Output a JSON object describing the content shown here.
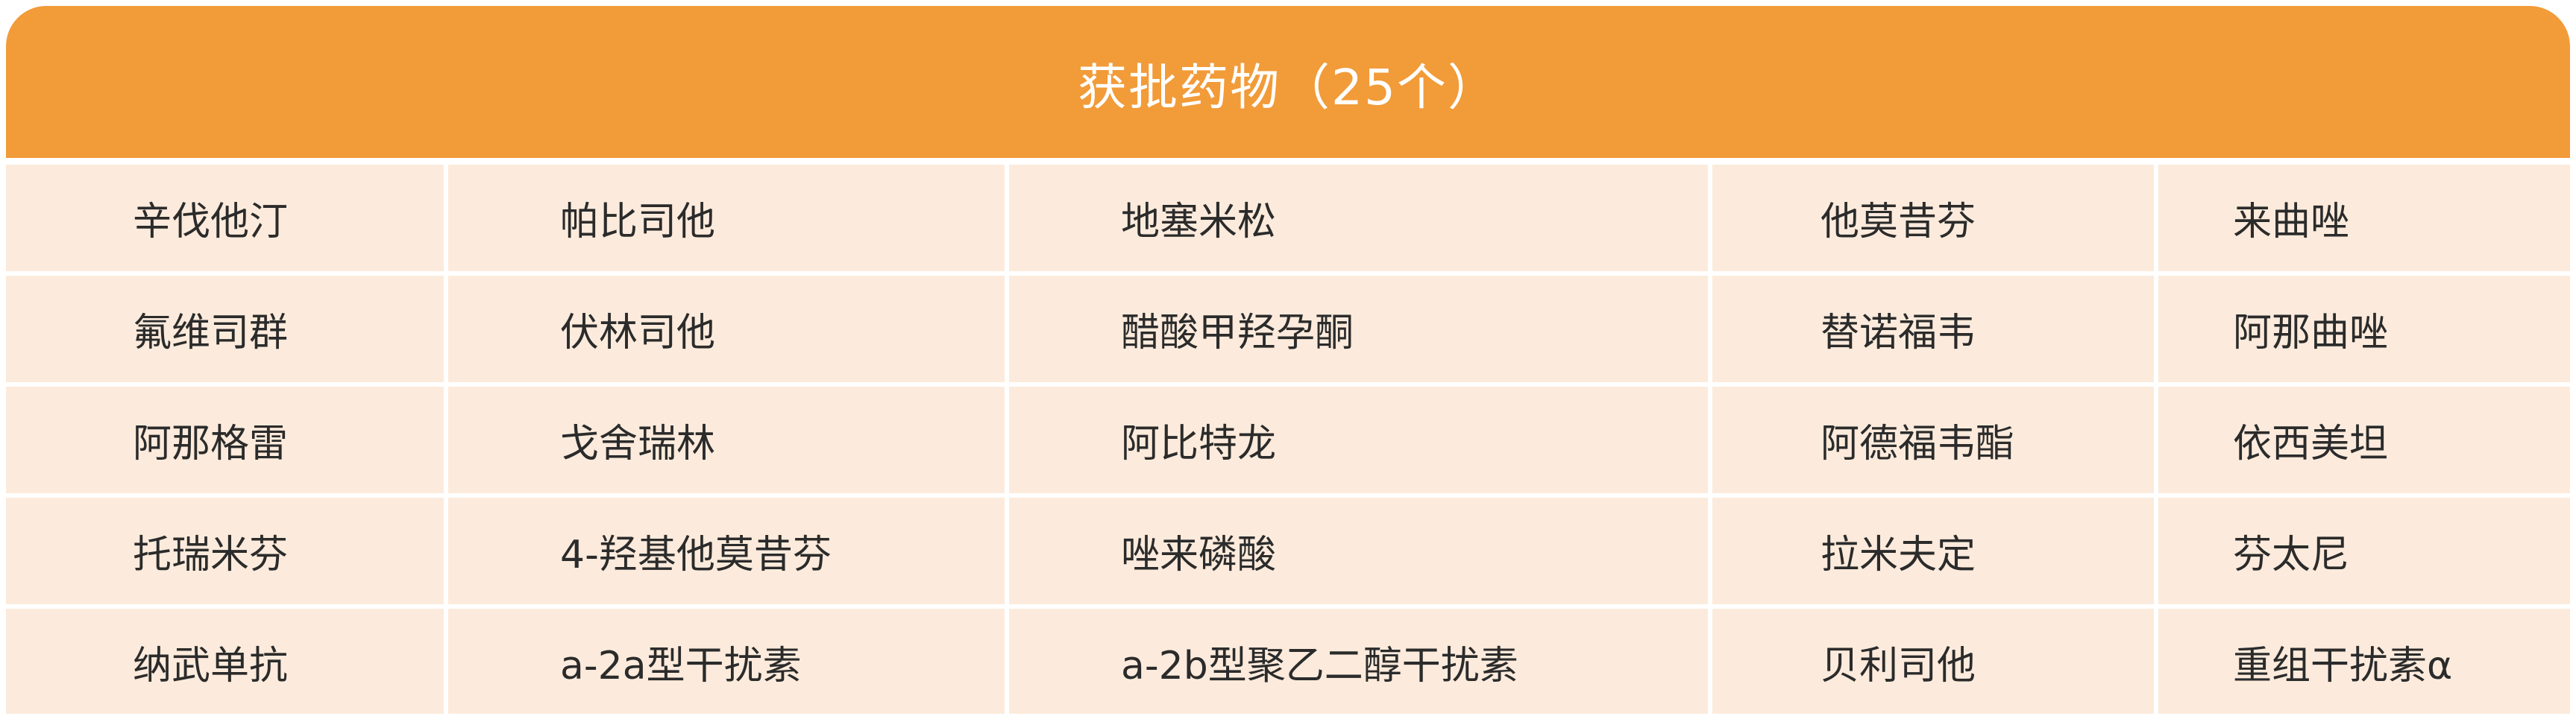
{
  "header": {
    "title": "获批药物（25个）"
  },
  "colors": {
    "header_bg": "#f29b39",
    "cell_bg": "#fcebdc",
    "text": "#2b2b2b"
  },
  "rows": [
    [
      "辛伐他汀",
      "帕比司他",
      "地塞米松",
      "他莫昔芬",
      "来曲唑"
    ],
    [
      "氟维司群",
      "伏林司他",
      "醋酸甲羟孕酮",
      "替诺福韦",
      "阿那曲唑"
    ],
    [
      "阿那格雷",
      "戈舍瑞林",
      "阿比特龙",
      "阿德福韦酯",
      "依西美坦"
    ],
    [
      "托瑞米芬",
      "4-羟基他莫昔芬",
      "唑来磷酸",
      "拉米夫定",
      "芬太尼"
    ],
    [
      "纳武单抗",
      "a-2a型干扰素",
      "a-2b型聚乙二醇干扰素",
      "贝利司他",
      "重组干扰素α"
    ]
  ]
}
